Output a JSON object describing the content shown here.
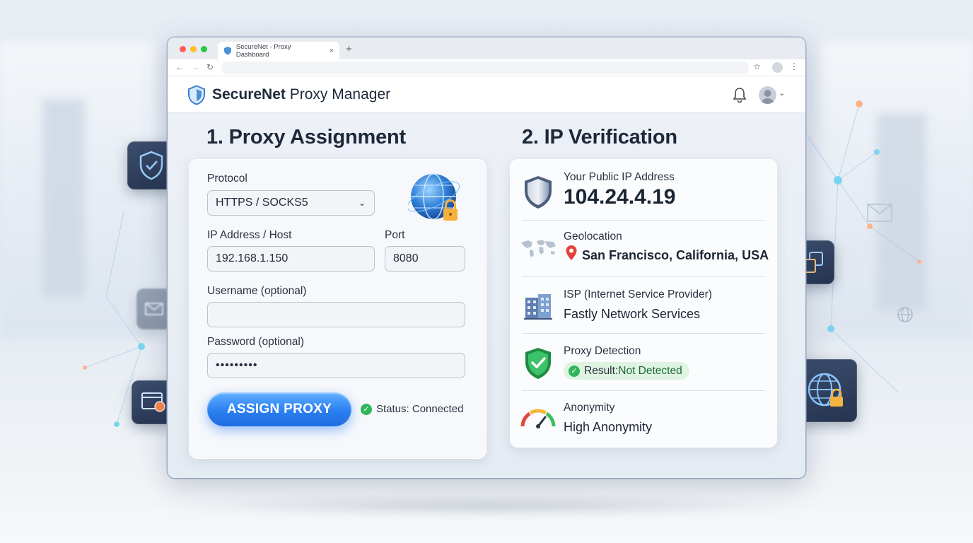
{
  "browser": {
    "tab_title": "SecureNet - Proxy Dashboard",
    "tab_close": "×",
    "new_tab": "+"
  },
  "app": {
    "title_bold": "SecureNet",
    "title_rest": " Proxy Manager"
  },
  "assignment": {
    "section_title": "1. Proxy Assignment",
    "protocol_label": "Protocol",
    "protocol_value": "HTTPS / SOCKS5",
    "host_label": "IP Address / Host",
    "host_value": "192.168.1.150",
    "port_label": "Port",
    "port_value": "8080",
    "username_label": "Username (optional)",
    "username_value": "",
    "password_label": "Password (optional)",
    "password_value": "•••••••••",
    "assign_button": "ASSIGN PROXY",
    "status_text": "Status: Connected"
  },
  "verification": {
    "section_title": "2. IP Verification",
    "public_ip_label": "Your Public IP Address",
    "public_ip_value": "104.24.4.19",
    "geo_label": "Geolocation",
    "geo_value": "San Francisco, California, USA",
    "isp_label": "ISP (Internet Service Provider)",
    "isp_value": "Fastly Network Services",
    "proxy_label": "Proxy Detection",
    "proxy_result_prefix": "Result: ",
    "proxy_result_value": "Not Detected",
    "anonymity_label": "Anonymity",
    "anonymity_value": "High Anonymity"
  },
  "colors": {
    "accent_blue": "#2b7ff0",
    "success_green": "#2fb55a",
    "shield_blue": "#4a8fd6"
  },
  "icons": [
    "shield-icon",
    "globe-lock-icon",
    "bell-icon",
    "user-avatar-icon",
    "map-pin-icon",
    "building-icon",
    "shield-check-icon",
    "gauge-icon"
  ]
}
